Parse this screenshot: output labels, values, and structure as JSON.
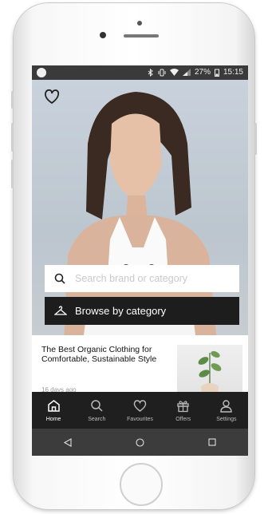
{
  "statusbar": {
    "battery": "27%",
    "time": "15:15"
  },
  "search": {
    "placeholder": "Search brand or category"
  },
  "browse": {
    "label": "Browse by category"
  },
  "article": {
    "title": "The Best Organic Clothing for Comfortable, Sustainable Style",
    "date": "16 days ago"
  },
  "tabbar": {
    "items": [
      {
        "label": "Home",
        "icon": "home-icon",
        "active": true
      },
      {
        "label": "Search",
        "icon": "search-icon",
        "active": false
      },
      {
        "label": "Favourites",
        "icon": "heart-icon",
        "active": false
      },
      {
        "label": "Offers",
        "icon": "gift-icon",
        "active": false
      },
      {
        "label": "Settings",
        "icon": "user-icon",
        "active": false
      }
    ]
  },
  "colors": {
    "tabbar_bg": "#1f1f1f",
    "browse_bg": "#1d1d1d",
    "navbar_bg": "#3c3c3c"
  }
}
